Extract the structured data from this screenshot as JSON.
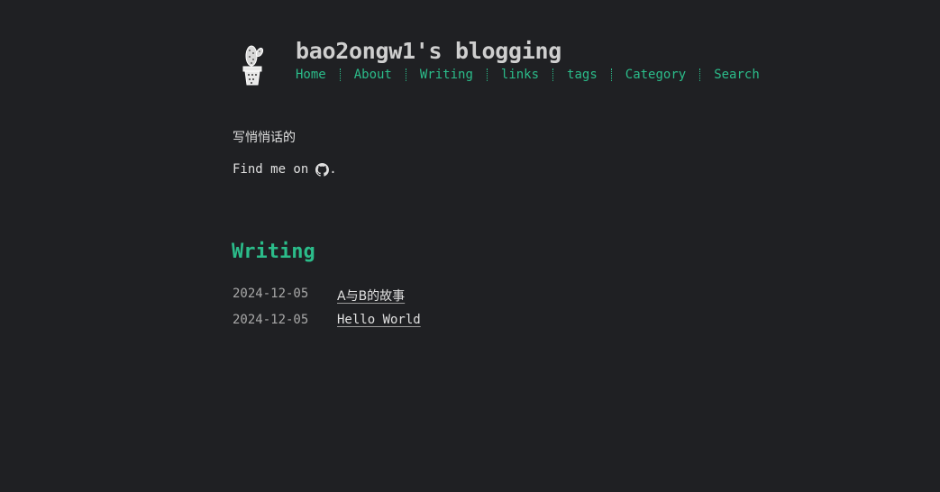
{
  "site": {
    "title": "bao2ongw1's blogging"
  },
  "nav": [
    {
      "label": "Home"
    },
    {
      "label": "About"
    },
    {
      "label": "Writing"
    },
    {
      "label": "links"
    },
    {
      "label": "tags"
    },
    {
      "label": "Category"
    },
    {
      "label": "Search"
    }
  ],
  "intro": {
    "tagline": "写悄悄话的",
    "findme_text": "Find me on",
    "findme_icon": "github-icon",
    "findme_suffix": "."
  },
  "writing": {
    "heading": "Writing",
    "posts": [
      {
        "date": "2024-12-05",
        "title": "A与B的故事"
      },
      {
        "date": "2024-12-05",
        "title": "Hello World"
      }
    ]
  },
  "colors": {
    "background": "#1f2023",
    "accent": "#2bbc8a",
    "text": "#dddddd"
  }
}
